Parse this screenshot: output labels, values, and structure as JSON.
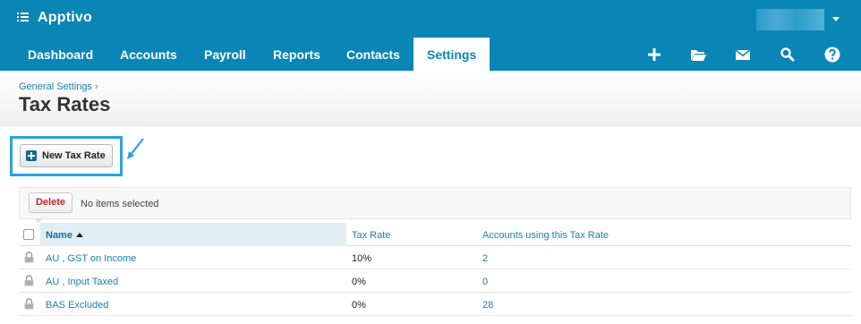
{
  "app": {
    "title": "Apptivo"
  },
  "nav": {
    "items": [
      {
        "label": "Dashboard"
      },
      {
        "label": "Accounts"
      },
      {
        "label": "Payroll"
      },
      {
        "label": "Reports"
      },
      {
        "label": "Contacts"
      },
      {
        "label": "Settings",
        "active": true
      }
    ],
    "icons": [
      "plus-icon",
      "folder-icon",
      "mail-icon",
      "search-icon",
      "help-icon"
    ]
  },
  "header": {
    "breadcrumb": "General Settings",
    "breadcrumb_sep": "›",
    "title": "Tax Rates"
  },
  "actions": {
    "new_tax_rate_label": "New Tax Rate"
  },
  "toolbar": {
    "delete_label": "Delete",
    "selection_status": "No items selected"
  },
  "table": {
    "columns": {
      "name": "Name",
      "tax_rate": "Tax Rate",
      "accounts": "Accounts using this Tax Rate"
    },
    "rows": [
      {
        "name": "AU , GST on Income",
        "rate": "10%",
        "accounts": "2"
      },
      {
        "name": "AU , Input Taxed",
        "rate": "0%",
        "accounts": "0"
      },
      {
        "name": "BAS Excluded",
        "rate": "0%",
        "accounts": "28"
      }
    ]
  },
  "colors": {
    "brand": "#0a86b6",
    "link": "#1a80b0",
    "danger": "#c0282d",
    "highlight": "#2aa3dd"
  }
}
